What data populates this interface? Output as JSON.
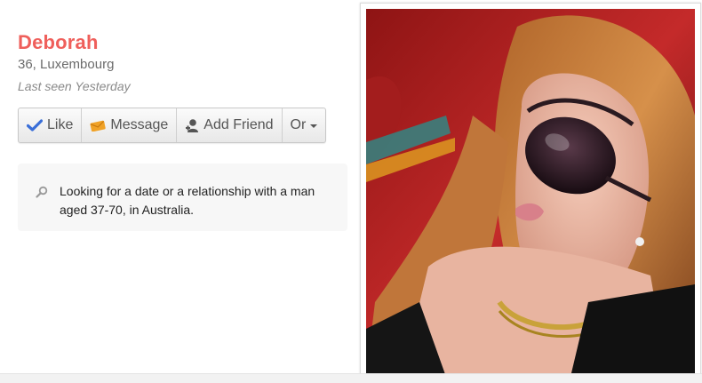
{
  "profile": {
    "name": "Deborah",
    "age_location": "36, Luxembourg",
    "last_seen": "Last seen Yesterday"
  },
  "actions": {
    "like": "Like",
    "message": "Message",
    "add_friend": "Add Friend",
    "or": "Or"
  },
  "looking_for": {
    "text": "Looking for a date or a relationship with a man aged 37-70, in Australia."
  },
  "icons": {
    "like": "checkmark-icon",
    "message": "envelope-icon",
    "add_friend": "add-person-icon",
    "or": "caret-down-icon",
    "looking": "search-icon"
  },
  "colors": {
    "name": "#ef5f5b",
    "check": "#3a6fd8",
    "envelope": "#f0a227",
    "panel_bg": "#f7f7f7"
  }
}
